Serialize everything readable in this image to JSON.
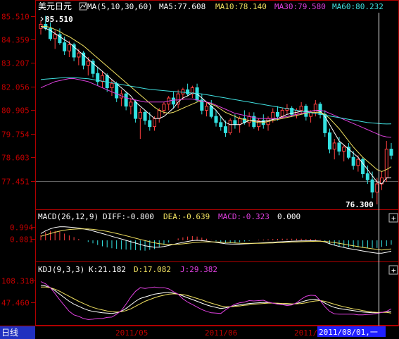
{
  "window": {
    "title": "美元日元",
    "period_tab": "日线",
    "cursor_date": "2011/08/01,一"
  },
  "colors": {
    "background": "#000000",
    "frame": "#b00000",
    "axis_text": "#c00000",
    "up": "#ff4040",
    "down": "#33e0e0",
    "ma5": "#ffffff",
    "ma10": "#f0e060",
    "ma30": "#e040e0",
    "ma60": "#40e0e0",
    "macd_diff": "#ffffff",
    "macd_dea": "#f0e060",
    "macd_hist_up": "#ff4040",
    "macd_hist_down": "#33e0e0",
    "kdj_k": "#ffffff",
    "kdj_d": "#f0e060",
    "kdj_j": "#e040e0",
    "tab_bg": "#2030c0",
    "date_bg": "#2020ff"
  },
  "main_panel": {
    "indicator_label": "MA(5,10,30,60)",
    "icon": "ma-toggle-icon",
    "ma_values": [
      {
        "label": "MA5:77.608"
      },
      {
        "label": "MA10:78.140"
      },
      {
        "label": "MA30:79.580"
      },
      {
        "label": "MA60:80.232"
      }
    ],
    "y_ticks": [
      "85.510",
      "84.359",
      "83.207",
      "82.056",
      "80.905",
      "79.754",
      "78.603",
      "77.451"
    ],
    "high_label": "85.510",
    "low_label": "76.300"
  },
  "macd_panel": {
    "title": "MACD(26,12,9)",
    "diff": "DIFF:-0.800",
    "dea": "DEA:-0.639",
    "macd": "MACD:-0.323",
    "extra": "0.000",
    "y_ticks": [
      "0.994",
      "0.081"
    ],
    "expand_button": "+"
  },
  "kdj_panel": {
    "title": "KDJ(9,3,3)",
    "k": "K:21.182",
    "d": "D:17.082",
    "j": "J:29.382",
    "y_ticks": [
      "108.318",
      "47.460"
    ],
    "expand_button": "+"
  },
  "x_axis": {
    "labels": [
      "2011/05",
      "2011/06",
      "2011/0"
    ]
  },
  "chart_data": {
    "type": "candlestick",
    "title": "美元日元",
    "ylim": [
      76.3,
      85.6
    ],
    "candles": [
      [
        84.9,
        85.3,
        84.6,
        85.1
      ],
      [
        85.1,
        85.51,
        84.8,
        84.9
      ],
      [
        84.9,
        85.2,
        84.3,
        84.4
      ],
      [
        84.4,
        84.8,
        83.9,
        84.6
      ],
      [
        84.6,
        84.9,
        84.1,
        84.2
      ],
      [
        84.2,
        84.5,
        83.6,
        83.8
      ],
      [
        83.8,
        84.3,
        83.5,
        84.1
      ],
      [
        84.1,
        84.2,
        83.3,
        83.5
      ],
      [
        83.5,
        83.9,
        83.1,
        83.7
      ],
      [
        83.7,
        83.8,
        82.9,
        83.1
      ],
      [
        83.1,
        83.5,
        82.6,
        83.3
      ],
      [
        83.3,
        83.4,
        82.5,
        82.7
      ],
      [
        82.7,
        83.0,
        82.1,
        82.3
      ],
      [
        82.3,
        82.8,
        82.0,
        82.6
      ],
      [
        82.6,
        82.7,
        81.8,
        82.0
      ],
      [
        82.0,
        82.4,
        81.6,
        82.2
      ],
      [
        82.2,
        82.3,
        81.3,
        81.5
      ],
      [
        81.5,
        81.9,
        81.1,
        81.7
      ],
      [
        81.7,
        81.8,
        80.9,
        81.1
      ],
      [
        81.1,
        81.5,
        80.7,
        81.3
      ],
      [
        81.3,
        81.4,
        80.3,
        80.5
      ],
      [
        80.5,
        81.0,
        79.5,
        80.8
      ],
      [
        80.8,
        80.9,
        80.2,
        80.4
      ],
      [
        80.4,
        80.8,
        79.9,
        80.1
      ],
      [
        80.1,
        80.6,
        79.9,
        80.5
      ],
      [
        80.5,
        81.0,
        80.3,
        80.9
      ],
      [
        80.9,
        81.3,
        80.7,
        81.2
      ],
      [
        81.2,
        81.6,
        80.9,
        81.5
      ],
      [
        81.5,
        81.8,
        81.0,
        81.2
      ],
      [
        81.2,
        81.9,
        81.0,
        81.7
      ],
      [
        81.7,
        82.0,
        81.4,
        81.9
      ],
      [
        81.9,
        82.2,
        81.6,
        81.7
      ],
      [
        81.7,
        82.1,
        81.5,
        82.0
      ],
      [
        82.0,
        82.2,
        81.3,
        81.4
      ],
      [
        81.4,
        81.7,
        80.7,
        80.9
      ],
      [
        80.9,
        81.3,
        80.6,
        81.1
      ],
      [
        81.1,
        81.4,
        80.5,
        80.6
      ],
      [
        80.6,
        80.9,
        80.1,
        80.3
      ],
      [
        80.3,
        80.6,
        79.9,
        80.1
      ],
      [
        80.1,
        80.4,
        79.6,
        79.8
      ],
      [
        79.8,
        80.5,
        79.7,
        80.4
      ],
      [
        80.4,
        80.7,
        80.0,
        80.2
      ],
      [
        80.2,
        80.6,
        79.8,
        80.5
      ],
      [
        80.5,
        80.9,
        80.2,
        80.3
      ],
      [
        80.3,
        80.8,
        80.1,
        80.6
      ],
      [
        80.6,
        80.8,
        80.0,
        80.1
      ],
      [
        80.1,
        80.5,
        79.9,
        80.4
      ],
      [
        80.4,
        80.7,
        80.0,
        80.2
      ],
      [
        80.2,
        80.6,
        79.9,
        80.5
      ],
      [
        80.5,
        81.0,
        80.3,
        80.8
      ],
      [
        80.8,
        81.1,
        80.4,
        80.6
      ],
      [
        80.6,
        81.0,
        80.5,
        80.9
      ],
      [
        80.9,
        81.2,
        80.7,
        81.0
      ],
      [
        81.0,
        81.1,
        80.6,
        80.7
      ],
      [
        80.7,
        81.0,
        80.5,
        80.9
      ],
      [
        80.9,
        81.3,
        80.7,
        81.1
      ],
      [
        81.1,
        81.2,
        80.4,
        80.6
      ],
      [
        80.6,
        80.9,
        80.3,
        80.8
      ],
      [
        80.8,
        81.4,
        80.6,
        81.2
      ],
      [
        81.2,
        81.3,
        80.5,
        80.7
      ],
      [
        80.7,
        80.9,
        79.6,
        79.8
      ],
      [
        79.8,
        80.0,
        78.8,
        79.0
      ],
      [
        79.0,
        79.5,
        78.5,
        79.3
      ],
      [
        79.3,
        79.6,
        78.7,
        78.9
      ],
      [
        78.9,
        79.2,
        78.4,
        79.1
      ],
      [
        79.1,
        79.3,
        78.5,
        78.6
      ],
      [
        78.6,
        78.9,
        78.0,
        78.2
      ],
      [
        78.2,
        78.7,
        77.9,
        78.5
      ],
      [
        78.5,
        78.6,
        77.6,
        77.8
      ],
      [
        77.8,
        78.2,
        77.3,
        77.5
      ],
      [
        77.5,
        77.9,
        76.6,
        76.9
      ],
      [
        76.9,
        77.6,
        76.3,
        77.3
      ],
      [
        77.3,
        77.9,
        77.0,
        77.6
      ],
      [
        77.6,
        79.4,
        77.4,
        79.0
      ],
      [
        79.0,
        79.3,
        78.5,
        78.7
      ]
    ],
    "ma_series": [
      {
        "name": "MA5",
        "values": [
          85.0,
          84.9,
          84.8,
          84.65,
          84.5,
          84.35,
          84.2,
          84.0,
          83.8,
          83.6,
          83.4,
          83.2,
          83.0,
          82.8,
          82.6,
          82.4,
          82.2,
          82.0,
          81.8,
          81.6,
          81.3,
          81.1,
          80.9,
          80.7,
          80.5,
          80.5,
          80.6,
          80.8,
          81.0,
          81.3,
          81.5,
          81.6,
          81.75,
          81.7,
          81.5,
          81.3,
          81.1,
          80.9,
          80.6,
          80.3,
          80.2,
          80.2,
          80.2,
          80.3,
          80.4,
          80.4,
          80.35,
          80.35,
          80.4,
          80.45,
          80.5,
          80.6,
          80.7,
          80.75,
          80.8,
          80.85,
          80.85,
          80.85,
          80.9,
          80.85,
          80.6,
          80.2,
          79.8,
          79.4,
          79.2,
          79.0,
          78.8,
          78.6,
          78.3,
          78.0,
          77.7,
          77.4,
          77.3,
          77.6,
          77.6
        ]
      },
      {
        "name": "MA10",
        "values": [
          85.0,
          85.0,
          84.95,
          84.85,
          84.75,
          84.6,
          84.5,
          84.35,
          84.2,
          84.05,
          83.85,
          83.65,
          83.45,
          83.25,
          83.05,
          82.85,
          82.65,
          82.45,
          82.25,
          82.05,
          81.85,
          81.65,
          81.45,
          81.25,
          81.05,
          80.9,
          80.8,
          80.75,
          80.8,
          80.9,
          81.0,
          81.1,
          81.2,
          81.3,
          81.35,
          81.3,
          81.2,
          81.1,
          80.95,
          80.8,
          80.7,
          80.6,
          80.5,
          80.45,
          80.4,
          80.35,
          80.3,
          80.3,
          80.35,
          80.4,
          80.45,
          80.5,
          80.55,
          80.6,
          80.65,
          80.7,
          80.75,
          80.8,
          80.8,
          80.8,
          80.7,
          80.5,
          80.25,
          80.0,
          79.7,
          79.4,
          79.1,
          78.85,
          78.6,
          78.4,
          78.2,
          78.0,
          77.9,
          78.0,
          78.14
        ]
      },
      {
        "name": "MA30",
        "values": [
          82.0,
          82.1,
          82.2,
          82.3,
          82.35,
          82.4,
          82.45,
          82.45,
          82.4,
          82.35,
          82.3,
          82.2,
          82.1,
          82.0,
          81.9,
          81.8,
          81.7,
          81.6,
          81.5,
          81.45,
          81.4,
          81.35,
          81.3,
          81.3,
          81.3,
          81.3,
          81.3,
          81.35,
          81.4,
          81.4,
          81.45,
          81.45,
          81.45,
          81.4,
          81.35,
          81.3,
          81.25,
          81.15,
          81.05,
          80.95,
          80.85,
          80.75,
          80.7,
          80.65,
          80.6,
          80.55,
          80.5,
          80.5,
          80.5,
          80.5,
          80.5,
          80.55,
          80.6,
          80.65,
          80.7,
          80.75,
          80.8,
          80.85,
          80.9,
          80.9,
          80.85,
          80.75,
          80.65,
          80.55,
          80.45,
          80.35,
          80.25,
          80.15,
          80.05,
          79.95,
          79.85,
          79.75,
          79.65,
          79.6,
          79.58
        ]
      },
      {
        "name": "MA60",
        "values": [
          82.4,
          82.42,
          82.44,
          82.46,
          82.48,
          82.5,
          82.5,
          82.5,
          82.48,
          82.46,
          82.44,
          82.4,
          82.36,
          82.32,
          82.28,
          82.24,
          82.2,
          82.16,
          82.12,
          82.08,
          82.04,
          82.0,
          81.96,
          81.92,
          81.9,
          81.88,
          81.86,
          81.84,
          81.82,
          81.8,
          81.78,
          81.76,
          81.74,
          81.72,
          81.7,
          81.66,
          81.62,
          81.58,
          81.54,
          81.5,
          81.46,
          81.42,
          81.38,
          81.34,
          81.3,
          81.26,
          81.22,
          81.18,
          81.14,
          81.1,
          81.06,
          81.02,
          80.98,
          80.94,
          80.9,
          80.86,
          80.82,
          80.78,
          80.74,
          80.7,
          80.66,
          80.62,
          80.58,
          80.54,
          80.5,
          80.46,
          80.42,
          80.38,
          80.34,
          80.3,
          80.28,
          80.26,
          80.24,
          80.23,
          80.232
        ]
      }
    ],
    "macd_ylim": [
      -1.4,
      1.3
    ],
    "macd_diff": [
      0.5,
      0.7,
      0.85,
      0.95,
      1.0,
      1.0,
      0.98,
      0.95,
      0.9,
      0.85,
      0.78,
      0.7,
      0.6,
      0.5,
      0.4,
      0.3,
      0.2,
      0.1,
      0.0,
      -0.1,
      -0.2,
      -0.3,
      -0.4,
      -0.45,
      -0.5,
      -0.5,
      -0.45,
      -0.38,
      -0.3,
      -0.22,
      -0.15,
      -0.08,
      -0.02,
      0.0,
      -0.02,
      -0.05,
      -0.1,
      -0.15,
      -0.2,
      -0.25,
      -0.27,
      -0.28,
      -0.28,
      -0.26,
      -0.24,
      -0.22,
      -0.2,
      -0.18,
      -0.16,
      -0.14,
      -0.12,
      -0.1,
      -0.08,
      -0.06,
      -0.05,
      -0.04,
      -0.04,
      -0.03,
      -0.03,
      -0.05,
      -0.12,
      -0.25,
      -0.35,
      -0.45,
      -0.52,
      -0.6,
      -0.66,
      -0.72,
      -0.78,
      -0.84,
      -0.9,
      -0.95,
      -0.95,
      -0.88,
      -0.8
    ],
    "macd_dea": [
      0.3,
      0.4,
      0.5,
      0.6,
      0.68,
      0.75,
      0.8,
      0.83,
      0.85,
      0.85,
      0.84,
      0.81,
      0.77,
      0.72,
      0.66,
      0.59,
      0.51,
      0.43,
      0.34,
      0.25,
      0.16,
      0.07,
      -0.02,
      -0.1,
      -0.18,
      -0.24,
      -0.28,
      -0.3,
      -0.3,
      -0.29,
      -0.26,
      -0.22,
      -0.18,
      -0.14,
      -0.12,
      -0.11,
      -0.11,
      -0.12,
      -0.13,
      -0.15,
      -0.17,
      -0.19,
      -0.21,
      -0.22,
      -0.22,
      -0.22,
      -0.22,
      -0.21,
      -0.2,
      -0.19,
      -0.17,
      -0.16,
      -0.14,
      -0.12,
      -0.11,
      -0.1,
      -0.09,
      -0.08,
      -0.07,
      -0.07,
      -0.08,
      -0.11,
      -0.16,
      -0.22,
      -0.28,
      -0.34,
      -0.4,
      -0.46,
      -0.52,
      -0.57,
      -0.62,
      -0.67,
      -0.71,
      -0.67,
      -0.639
    ],
    "kdj_ylim": [
      -10,
      120
    ],
    "kdj_k": [
      95,
      93,
      88,
      80,
      70,
      60,
      50,
      42,
      36,
      30,
      25,
      22,
      20,
      18,
      17,
      16,
      18,
      22,
      30,
      40,
      50,
      58,
      62,
      66,
      70,
      72,
      74,
      75,
      73,
      70,
      65,
      60,
      55,
      50,
      45,
      40,
      36,
      33,
      30,
      32,
      35,
      38,
      40,
      42,
      44,
      45,
      46,
      47,
      46,
      45,
      44,
      43,
      42,
      42,
      44,
      48,
      52,
      55,
      56,
      52,
      45,
      38,
      33,
      30,
      28,
      26,
      24,
      22,
      20,
      19,
      18,
      18,
      19,
      20,
      21
    ],
    "kdj_d": [
      90,
      90,
      88,
      84,
      78,
      71,
      64,
      57,
      50,
      44,
      38,
      33,
      29,
      26,
      23,
      21,
      20,
      21,
      24,
      29,
      36,
      43,
      50,
      55,
      60,
      64,
      67,
      70,
      71,
      70,
      69,
      66,
      62,
      58,
      54,
      49,
      45,
      41,
      37,
      35,
      35,
      36,
      37,
      39,
      40,
      42,
      43,
      44,
      45,
      45,
      45,
      44,
      44,
      43,
      43,
      44,
      46,
      49,
      51,
      52,
      50,
      46,
      42,
      38,
      35,
      32,
      29,
      27,
      24,
      22,
      20,
      19,
      19,
      19,
      17
    ]
  }
}
